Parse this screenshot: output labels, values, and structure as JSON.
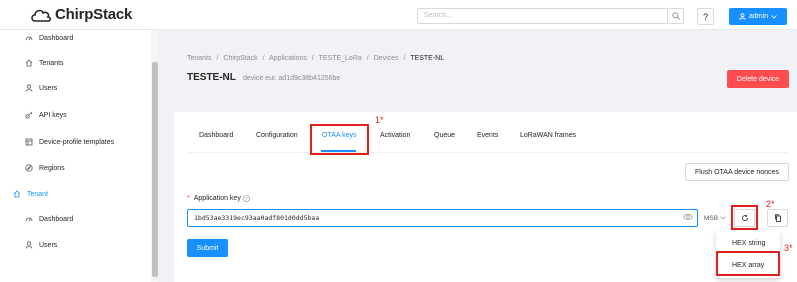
{
  "app": {
    "brand": "ChirpStack"
  },
  "header": {
    "search_placeholder": "Search...",
    "help_label": "?",
    "user_label": "admin",
    "search_icon": "search-icon",
    "user_icon": "user-icon"
  },
  "sidebar": {
    "items": [
      {
        "label": "Dashboard",
        "icon": "dashboard-icon"
      },
      {
        "label": "Tenants",
        "icon": "home-icon"
      },
      {
        "label": "Users",
        "icon": "user-icon"
      },
      {
        "label": "API keys",
        "icon": "key-icon"
      },
      {
        "label": "Device-profile templates",
        "icon": "template-icon"
      },
      {
        "label": "Regions",
        "icon": "compass-icon"
      },
      {
        "label": "Tenant",
        "icon": "home-icon",
        "active": true
      },
      {
        "label": "Dashboard",
        "icon": "dashboard-icon"
      },
      {
        "label": "Users",
        "icon": "user-icon"
      }
    ]
  },
  "breadcrumb": {
    "items": [
      "Tenants",
      "ChirpStack",
      "Applications",
      "TESTE_LoRa",
      "Devices",
      "TESTE-NL"
    ],
    "separator": "/"
  },
  "page": {
    "title": "TESTE-NL",
    "subtitle": "device eui: ad1d9c38b41256be",
    "delete_label": "Delete device"
  },
  "tabs": [
    {
      "label": "Dashboard"
    },
    {
      "label": "Configuration"
    },
    {
      "label": "OTAA keys",
      "active": true
    },
    {
      "label": "Activation"
    },
    {
      "label": "Queue"
    },
    {
      "label": "Events"
    },
    {
      "label": "LoRaWAN frames"
    }
  ],
  "form": {
    "flush_label": "Flush OTAA device nonces",
    "required_mark": "*",
    "app_key_label": "Application key",
    "app_key_value": "1bd53ae3319ec93aa0adf801d0dd5baa",
    "byte_order": "MSB",
    "submit_label": "Submit"
  },
  "dropdown": {
    "items": [
      "HEX string",
      "HEX array"
    ]
  },
  "annotations": {
    "marks": [
      "1*",
      "2*",
      "3*"
    ],
    "color": "#e0211c"
  },
  "colors": {
    "primary": "#1890ff",
    "danger": "#ff4d4f"
  }
}
